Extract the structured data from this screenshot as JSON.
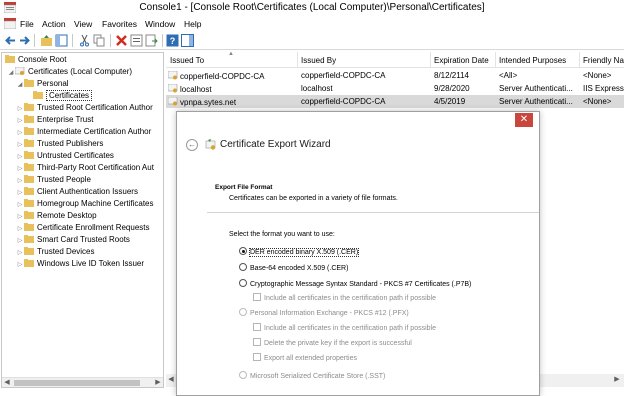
{
  "window": {
    "title": "Console1 - [Console Root\\Certificates (Local Computer)\\Personal\\Certificates]"
  },
  "menu": {
    "items": [
      "File",
      "Action",
      "View",
      "Favorites",
      "Window",
      "Help"
    ]
  },
  "tree": {
    "root": "Console Root",
    "store": "Certificates (Local Computer)",
    "personal": "Personal",
    "certificates": "Certificates",
    "items": [
      "Trusted Root Certification Author",
      "Enterprise Trust",
      "Intermediate Certification Author",
      "Trusted Publishers",
      "Untrusted Certificates",
      "Third-Party Root Certification Aut",
      "Trusted People",
      "Client Authentication Issuers",
      "Homegroup Machine Certificates",
      "Remote Desktop",
      "Certificate Enrollment Requests",
      "Smart Card Trusted Roots",
      "Trusted Devices",
      "Windows Live ID Token Issuer"
    ]
  },
  "list": {
    "columns": [
      "Issued To",
      "Issued By",
      "Expiration Date",
      "Intended Purposes",
      "Friendly Na"
    ],
    "rows": [
      {
        "issued_to": "copperfield-COPDC-CA",
        "issued_by": "copperfield-COPDC-CA",
        "expires": "8/12/2114",
        "purposes": "<All>",
        "friendly": "<None>"
      },
      {
        "issued_to": "localhost",
        "issued_by": "localhost",
        "expires": "9/28/2020",
        "purposes": "Server Authenticati...",
        "friendly": "IIS Express D"
      },
      {
        "issued_to": "vpnpa.sytes.net",
        "issued_by": "copperfield-COPDC-CA",
        "expires": "4/5/2019",
        "purposes": "Server Authenticati...",
        "friendly": "<None>"
      }
    ]
  },
  "wizard": {
    "title": "Certificate Export Wizard",
    "close_glyph": "✕",
    "section_title": "Export File Format",
    "section_desc": "Certificates can be exported in a variety of file formats.",
    "prompt": "Select the format you want to use:",
    "options": {
      "der": "DER encoded binary X.509 (.CER)",
      "base64": "Base-64 encoded X.509 (.CER)",
      "pkcs7": "Cryptographic Message Syntax Standard - PKCS #7 Certificates (.P7B)",
      "pkcs7_include": "Include all certificates in the certification path if possible",
      "pfx": "Personal Information Exchange - PKCS #12 (.PFX)",
      "pfx_include": "Include all certificates in the certification path if possible",
      "pfx_delete": "Delete the private key if the export is successful",
      "pfx_export_props": "Export all extended properties",
      "sst": "Microsoft Serialized Certificate Store (.SST)"
    },
    "selected_option": "der"
  },
  "colors": {
    "close_button": "#c9463d",
    "folder": "#e8c15c",
    "selection": "#d9d9d9",
    "toolbar_blue": "#2f6db3"
  }
}
